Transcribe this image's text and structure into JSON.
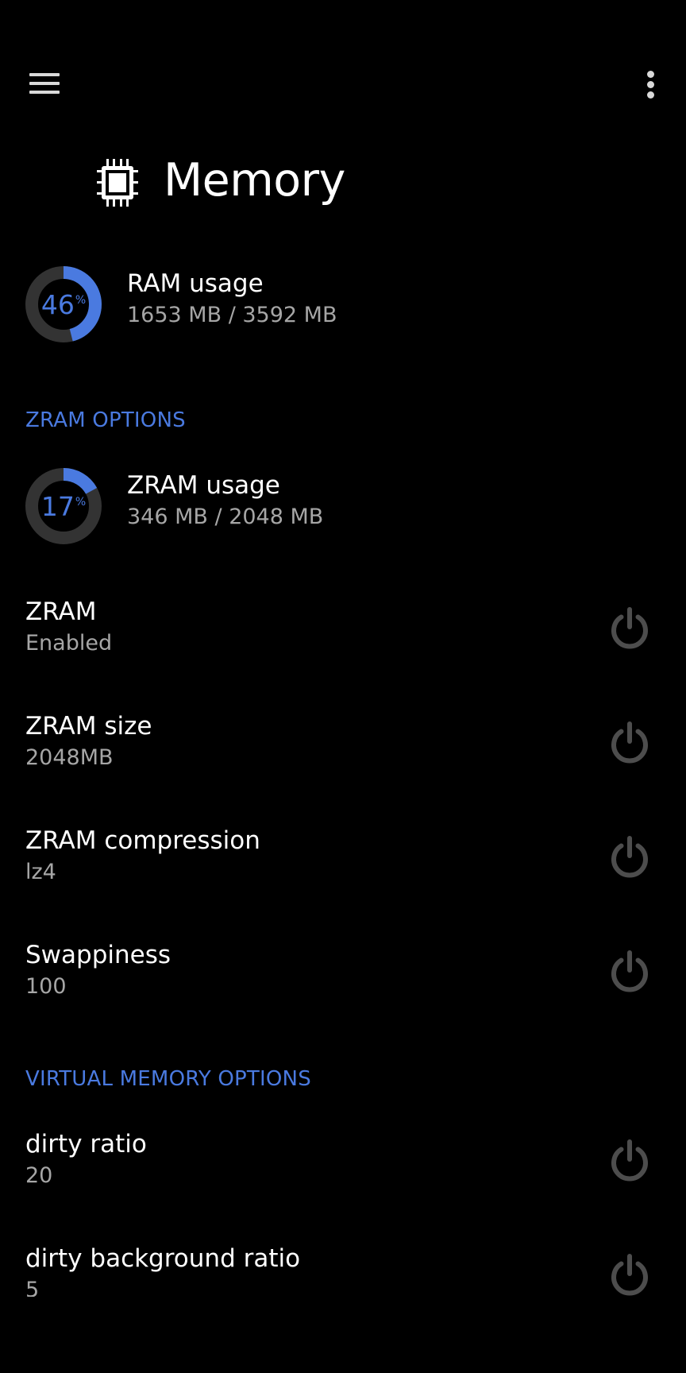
{
  "toolbar": {
    "menu_icon": "hamburger-menu-icon",
    "overflow_icon": "more-vert-icon"
  },
  "header": {
    "icon": "memory-chip-icon",
    "title": "Memory"
  },
  "ram": {
    "percent": 46,
    "percent_label": "46",
    "percent_sign": "%",
    "title": "RAM usage",
    "detail": "1653 MB / 3592 MB"
  },
  "zram_section": {
    "title": "ZRAM OPTIONS"
  },
  "zram_usage": {
    "percent": 17,
    "percent_label": "17",
    "percent_sign": "%",
    "title": "ZRAM usage",
    "detail": "346 MB / 2048 MB"
  },
  "zram_settings": [
    {
      "title": "ZRAM",
      "value": "Enabled",
      "icon": "power-icon"
    },
    {
      "title": "ZRAM size",
      "value": "2048MB",
      "icon": "power-icon"
    },
    {
      "title": "ZRAM compression",
      "value": "lz4",
      "icon": "power-icon"
    },
    {
      "title": "Swappiness",
      "value": "100",
      "icon": "power-icon"
    }
  ],
  "vm_section": {
    "title": "VIRTUAL MEMORY OPTIONS"
  },
  "vm_settings": [
    {
      "title": "dirty ratio",
      "value": "20",
      "icon": "power-icon"
    },
    {
      "title": "dirty background ratio",
      "value": "5",
      "icon": "power-icon"
    }
  ],
  "colors": {
    "background": "#000000",
    "accent": "#4a7ae0",
    "donut_track": "#333333",
    "primary_text": "#ffffff",
    "secondary_text": "#a6a6a6",
    "icon_gray": "#4d4d4d"
  }
}
